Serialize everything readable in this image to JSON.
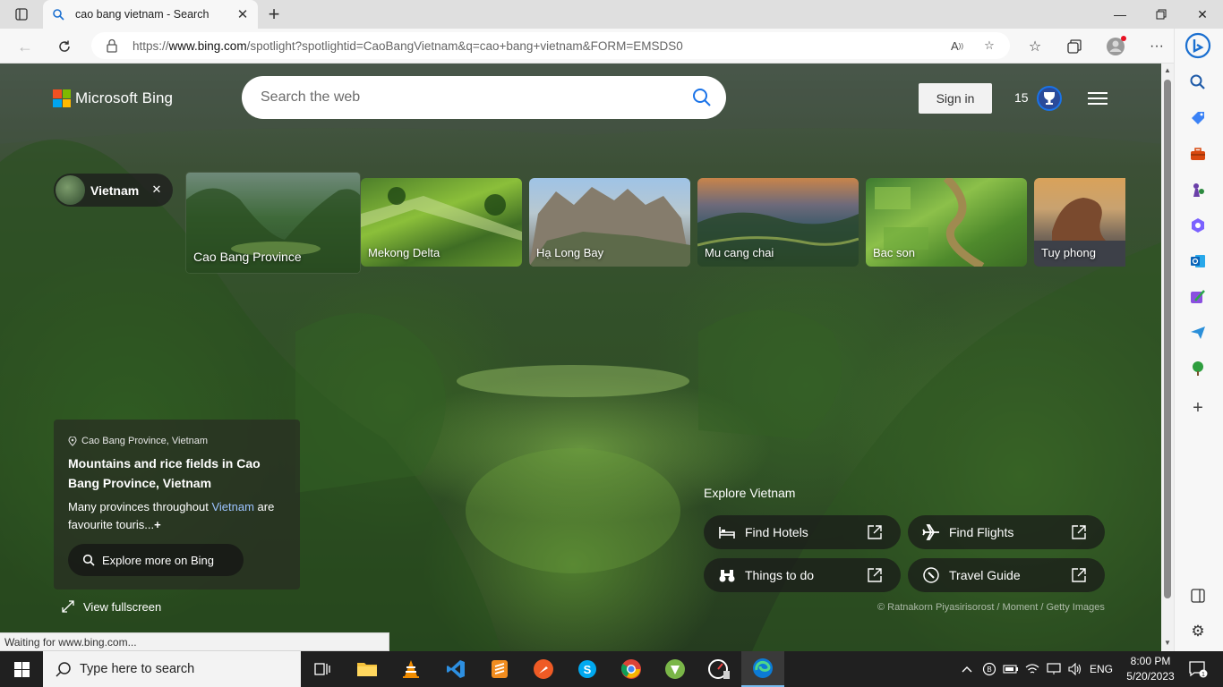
{
  "browser": {
    "tab_title": "cao bang vietnam - Search",
    "url_prefix": "https://",
    "url_host": "www.bing.com",
    "url_rest": "/spotlight?spotlightid=CaoBangVietnam&q=cao+bang+vietnam&FORM=EMSDS0",
    "status_text": "Waiting for www.bing.com..."
  },
  "bing": {
    "logo_text": "Microsoft Bing",
    "search_placeholder": "Search the web",
    "signin_label": "Sign in",
    "rewards_count": "15"
  },
  "topic_chip": {
    "label": "Vietnam"
  },
  "carousel": [
    {
      "label": "Cao Bang Province",
      "active": true
    },
    {
      "label": "Mekong Delta"
    },
    {
      "label": "Hạ Long Bay"
    },
    {
      "label": "Mu cang chai"
    },
    {
      "label": "Bac son"
    },
    {
      "label": "Tuy phong"
    }
  ],
  "info": {
    "location": "Cao Bang Province, Vietnam",
    "headline": "Mountains and rice fields in Cao Bang Province, Vietnam",
    "desc_start": "Many provinces throughout ",
    "desc_link": "Vietnam",
    "desc_end": " are favourite touris...",
    "desc_more": "+",
    "explore_button": "Explore more on Bing",
    "fullscreen_label": "View fullscreen"
  },
  "explore": {
    "title": "Explore Vietnam",
    "links": [
      {
        "label": "Find Hotels",
        "icon": "bed-icon"
      },
      {
        "label": "Find Flights",
        "icon": "airplane-icon"
      },
      {
        "label": "Things to do",
        "icon": "binoculars-icon"
      },
      {
        "label": "Travel Guide",
        "icon": "compass-icon"
      }
    ]
  },
  "credit": "© Ratnakorn Piyasirisorost / Moment / Getty Images",
  "taskbar": {
    "search_placeholder": "Type here to search",
    "language": "ENG",
    "time": "8:00 PM",
    "date": "5/20/2023"
  },
  "colors": {
    "accent_blue": "#1a73e8",
    "page_green": "#33512a",
    "taskbar": "#202020"
  }
}
